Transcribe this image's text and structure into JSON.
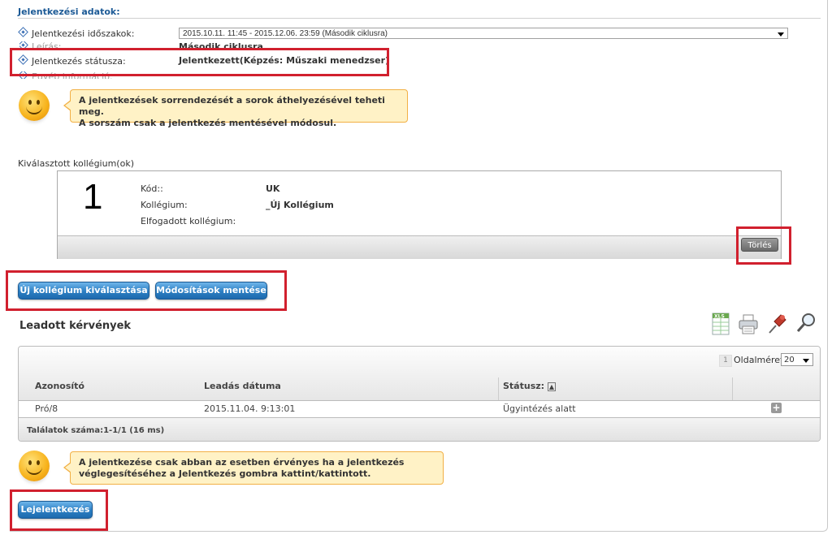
{
  "section_title": "Jelentkezési adatok:",
  "fields": {
    "idoszakok_label": "Jelentkezési időszakok:",
    "idoszakok_value": "2015.10.11. 11:45 - 2015.12.06. 23:59 (Második ciklusra)",
    "leiras_label": "Leírás:",
    "leiras_value": "Második ciklusra",
    "statusz_label": "Jelentkezés státusza:",
    "statusz_value": "Jelentkezett(Képzés: Műszaki menedzser)",
    "egyeb_label": "Egyéb információ:"
  },
  "info1": {
    "line1": "A jelentkezések sorrendezését a sorok áthelyezésével teheti meg.",
    "line2": "A sorszám csak a jelentkezés mentésével módosul."
  },
  "kollegium": {
    "section_label": "Kiválasztott kollégium(ok)",
    "number": "1",
    "kod_label": "Kód::",
    "kod_value": "UK",
    "kollegium_label": "Kollégium:",
    "kollegium_value": "_Új Kollégium",
    "elfogadott_label": "Elfogadott kollégium:",
    "delete_button": "Törlés"
  },
  "buttons": {
    "uj_kollegium": "Új kollégium kiválasztása",
    "mentes": "Módosítások mentése",
    "lejelentkezes": "Lejelentkezés"
  },
  "kervenyek": {
    "title": "Leadott kérvények",
    "page_number": "1",
    "page_size_label": "Oldalméret",
    "page_size_value": "20",
    "columns": [
      "Azonosító",
      "Leadás dátuma",
      "Státusz:"
    ],
    "rows": [
      {
        "azonosito": "Pró/8",
        "datum": "2015.11.04. 9:13:01",
        "statusz": "Ügyintézés alatt"
      }
    ],
    "footer": "Találatok száma:1-1/1 (16 ms)",
    "export_icon_label": "XLS"
  },
  "info2": {
    "line1": "A jelentkezése csak abban az esetben érvényes ha a jelentkezés",
    "line2": "véglegesítéséhez a Jelentkezés gombra kattint/kattintott."
  },
  "colors": {
    "accent_red": "#d1202e",
    "title_blue": "#1c5a96",
    "button_blue": "#2c7fc3",
    "bubble_bg": "#fff2c6",
    "bubble_border": "#f2b046"
  }
}
